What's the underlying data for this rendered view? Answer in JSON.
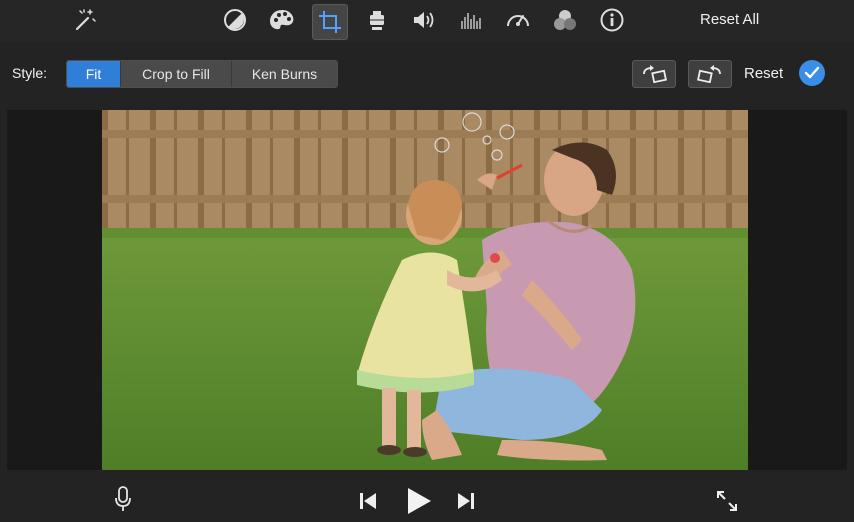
{
  "toolbar": {
    "icons": [
      "magic-wand-icon",
      "color-balance-icon",
      "color-palette-icon",
      "crop-icon",
      "stabilization-icon",
      "volume-icon",
      "equalizer-icon",
      "speed-icon",
      "clip-filter-icon",
      "info-icon"
    ],
    "active": "crop-icon",
    "reset_all_label": "Reset All"
  },
  "style_bar": {
    "label": "Style:",
    "options": [
      "Fit",
      "Crop to Fill",
      "Ken Burns"
    ],
    "selected": "Fit",
    "reset_label": "Reset",
    "accent_color": "#2f7fd9"
  },
  "playback": {
    "icons": [
      "microphone-icon",
      "skip-back-icon",
      "play-icon",
      "skip-forward-icon",
      "fullscreen-icon"
    ]
  }
}
